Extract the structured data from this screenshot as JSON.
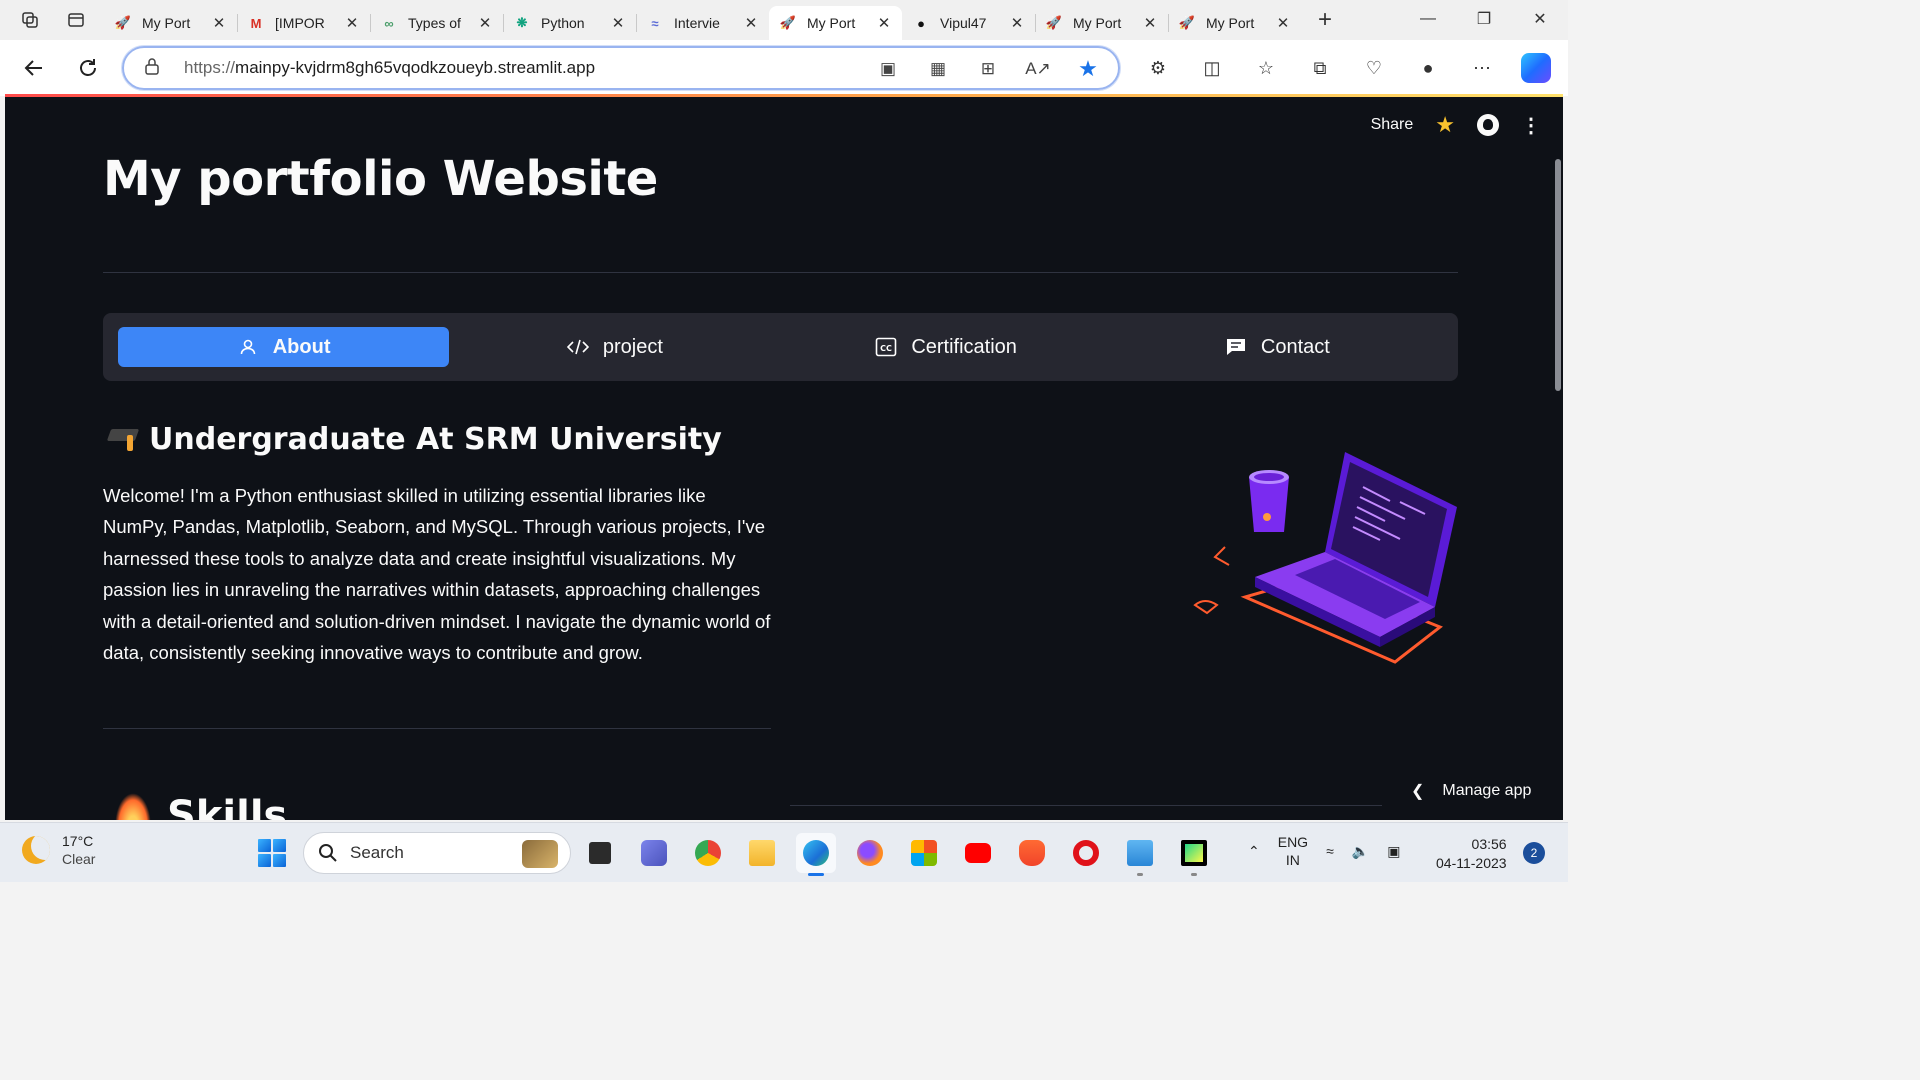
{
  "browser": {
    "tabs": [
      {
        "label": "My Port",
        "icon": "rocket-icon",
        "active": false
      },
      {
        "label": "[IMPOR",
        "icon": "gmail-icon",
        "active": false
      },
      {
        "label": "Types of",
        "icon": "link-icon",
        "active": false
      },
      {
        "label": "Python",
        "icon": "chatgpt-icon",
        "active": false
      },
      {
        "label": "Intervie",
        "icon": "interview-icon",
        "active": false
      },
      {
        "label": "My Port",
        "icon": "rocket-icon",
        "active": true
      },
      {
        "label": "Vipul47",
        "icon": "github-icon",
        "active": false
      },
      {
        "label": "My Port",
        "icon": "rocket-icon",
        "active": false
      },
      {
        "label": "My Port",
        "icon": "rocket-icon",
        "active": false
      }
    ],
    "url_scheme": "https://",
    "url_host": "mainpy-kvjdrm8gh65vqodkzoueyb.streamlit.app"
  },
  "app": {
    "header": {
      "share_label": "Share"
    },
    "title": "My portfolio Website",
    "menu": [
      {
        "label": "About",
        "icon": "person-icon",
        "selected": true
      },
      {
        "label": "project",
        "icon": "code-icon",
        "selected": false
      },
      {
        "label": "Certification",
        "icon": "cc-icon",
        "selected": false
      },
      {
        "label": "Contact",
        "icon": "chat-icon",
        "selected": false
      }
    ],
    "heading": "Undergraduate At SRM University",
    "paragraph": "Welcome! I'm a Python enthusiast skilled in utilizing essential libraries like NumPy, Pandas, Matplotlib, Seaborn, and MySQL. Through various projects, I've harnessed these tools to analyze data and create insightful visualizations. My passion lies in unraveling the narratives within datasets, approaching challenges with a detail-oriented and solution-driven mindset. I navigate the dynamic world of data, consistently seeking innovative ways to contribute and grow.",
    "skills_heading": "Skills",
    "manage_app": "Manage app"
  },
  "taskbar": {
    "weather_temp": "17°C",
    "weather_desc": "Clear",
    "search_placeholder": "Search",
    "lang_1": "ENG",
    "lang_2": "IN",
    "time": "03:56",
    "date": "04-11-2023",
    "notification_count": "2"
  },
  "colors": {
    "page_bg": "#0e1117",
    "menu_bg": "#262730",
    "menu_selected": "#3d86f7",
    "text": "#fafafa"
  }
}
